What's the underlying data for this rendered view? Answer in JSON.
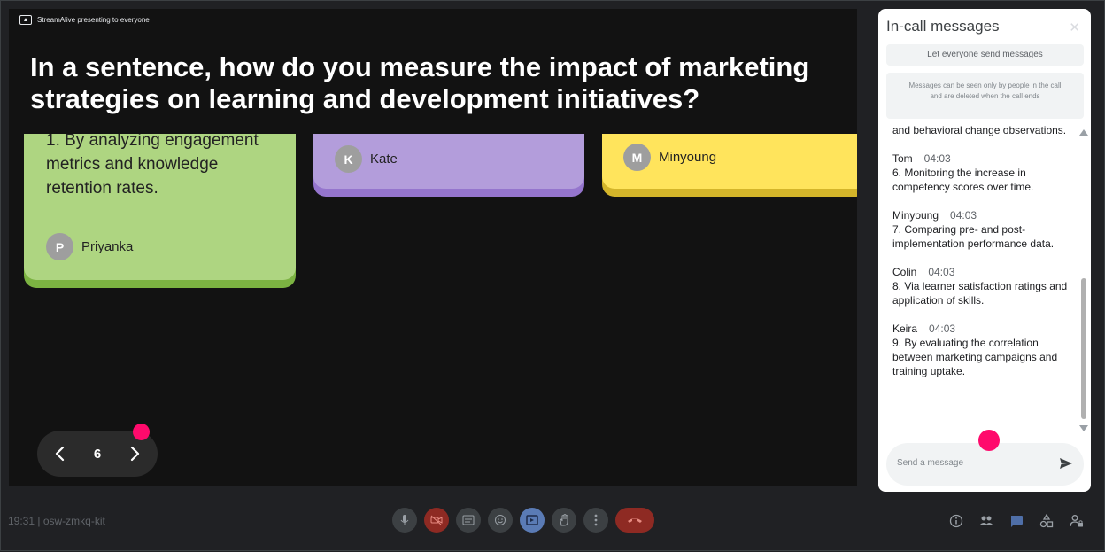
{
  "presentation": {
    "presenting_label": "StreamAlive presenting to everyone",
    "question": "In a sentence, how do you measure the impact of marketing strategies on learning and development initiatives?",
    "cards": [
      {
        "text": "1. By analyzing engagement metrics and knowledge retention rates.",
        "author": "Priyanka",
        "initial": "P",
        "color": "#aed581"
      },
      {
        "text": "",
        "author": "Kate",
        "initial": "K",
        "color": "#b39ddb"
      },
      {
        "text": "",
        "author": "Minyoung",
        "initial": "M",
        "color": "#ffe45c"
      }
    ],
    "page_number": "6"
  },
  "chat": {
    "title": "In-call messages",
    "toggle_label": "Let everyone send messages",
    "info_text": "Messages can be seen only by people in the call and are deleted when the call ends",
    "partial_message": "and behavioral change observations.",
    "messages": [
      {
        "sender": "Tom",
        "time": "04:03",
        "text": "6. Monitoring the increase in competency scores over time."
      },
      {
        "sender": "Minyoung",
        "time": "04:03",
        "text": "7. Comparing pre- and post-implementation performance data."
      },
      {
        "sender": "Colin",
        "time": "04:03",
        "text": "8. Via learner satisfaction ratings and application of skills."
      },
      {
        "sender": "Keira",
        "time": "04:03",
        "text": "9. By evaluating the correlation between marketing campaigns and training uptake."
      }
    ],
    "input_placeholder": "Send a message"
  },
  "bottom_bar": {
    "meeting_info": "19:31 | osw-zmkq-kit"
  },
  "colors": {
    "accent_pink": "#ff0a6c",
    "stage_background": "#121212",
    "end_call_red": "#8e2a23"
  }
}
